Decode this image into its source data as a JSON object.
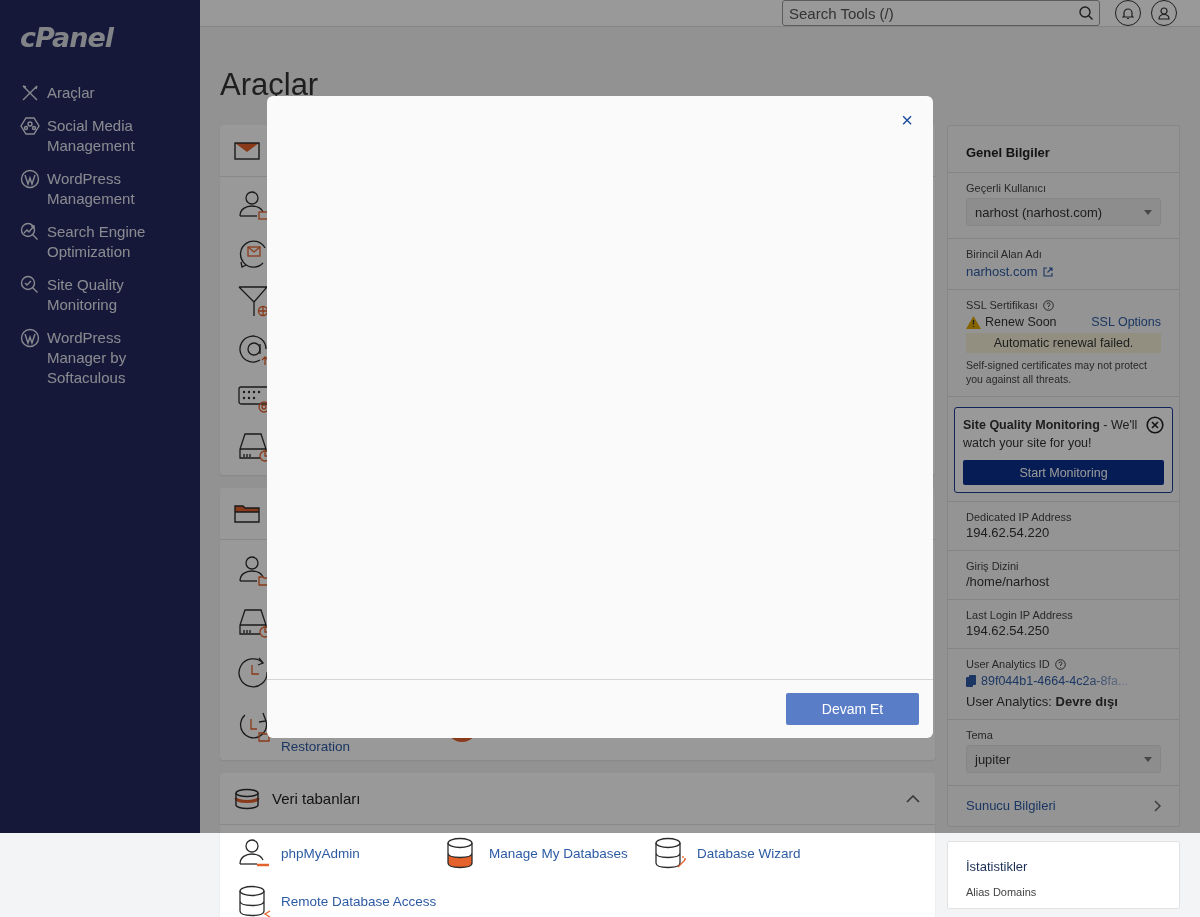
{
  "sidebar": {
    "logo": "cPanel",
    "items": [
      {
        "kind": "tools",
        "label": "Araçlar"
      },
      {
        "kind": "social",
        "label": "Social Media Management"
      },
      {
        "kind": "wordpress",
        "label": "WordPress Management"
      },
      {
        "kind": "seo",
        "label": "Search Engine Optimization"
      },
      {
        "kind": "monitor",
        "label": "Site Quality Monitoring"
      },
      {
        "kind": "wordpress",
        "label": "WordPress Manager by Softaculous"
      }
    ]
  },
  "header": {
    "search": {
      "placeholder": "Search Tools (/)"
    }
  },
  "page_title": "Araçlar",
  "tool_groups": [
    {
      "kind": "email",
      "rows": [
        [
          {
            "kind": "user-mail"
          }
        ],
        [
          {
            "kind": "mail-cycle"
          }
        ],
        [
          {
            "kind": "filter-globe"
          }
        ],
        [
          {
            "kind": "at-arrow"
          }
        ],
        [
          {
            "kind": "keyboard-at"
          }
        ],
        [
          {
            "kind": "disk-pie"
          }
        ]
      ]
    },
    {
      "kind": "files",
      "rows": [
        [
          {
            "kind": "user-folder"
          }
        ],
        [
          {
            "kind": "disk-pie"
          }
        ],
        [
          {
            "kind": "clock-restore"
          }
        ],
        [
          {
            "kind": "restore-folder",
            "label": "Restoration"
          },
          {
            "kind": "orange-disc"
          }
        ]
      ]
    },
    {
      "kind": "database",
      "title": "Veri tabanları",
      "expanded": true,
      "rows": [
        [
          {
            "kind": "db-user",
            "label": "phpMyAdmin"
          },
          {
            "kind": "db-filled",
            "label": "Manage My Databases"
          },
          {
            "kind": "db-wand",
            "label": "Database Wizard"
          }
        ],
        [
          {
            "kind": "db-remote",
            "label": "Remote Database Access"
          }
        ]
      ]
    }
  ],
  "general_info": {
    "title": "Genel Bilgiler",
    "sections": [
      {
        "kind": "select",
        "label": "Geçerli Kullanıcı",
        "value": "narhost (narhost.com)"
      },
      {
        "kind": "link",
        "label": "Birincil Alan Adı",
        "value": "narhost.com"
      },
      {
        "kind": "ssl",
        "label": "SSL Sertifikası",
        "status": "Renew Soon",
        "action": "SSL Options",
        "alert": "Automatic renewal failed.",
        "note": "Self-signed certificates may not protect you against all threats."
      },
      {
        "kind": "promo",
        "text": "**Site Quality Monitoring** - We'll watch your site for you!",
        "button": "Start Monitoring"
      },
      {
        "kind": "text",
        "label": "Dedicated IP Address",
        "value": "194.62.54.220"
      },
      {
        "kind": "text",
        "label": "Giriş Dizini",
        "value": "/home/narhost"
      },
      {
        "kind": "text",
        "label": "Last Login IP Address",
        "value": "194.62.54.250"
      },
      {
        "kind": "analytics",
        "label": "User Analytics ID",
        "value": "89f044b1-4664-4c2a-8fa...",
        "status": "User Analytics: **Devre dışı**"
      },
      {
        "kind": "select",
        "label": "Tema",
        "value": "jupiter"
      },
      {
        "kind": "nav",
        "label": "Sunucu Bilgileri"
      }
    ]
  },
  "stats": {
    "title": "İstatistikler",
    "items": [
      {
        "label": "Alias Domains"
      }
    ]
  },
  "modal": {
    "open": true,
    "close": "×",
    "button": "Devam Et"
  }
}
